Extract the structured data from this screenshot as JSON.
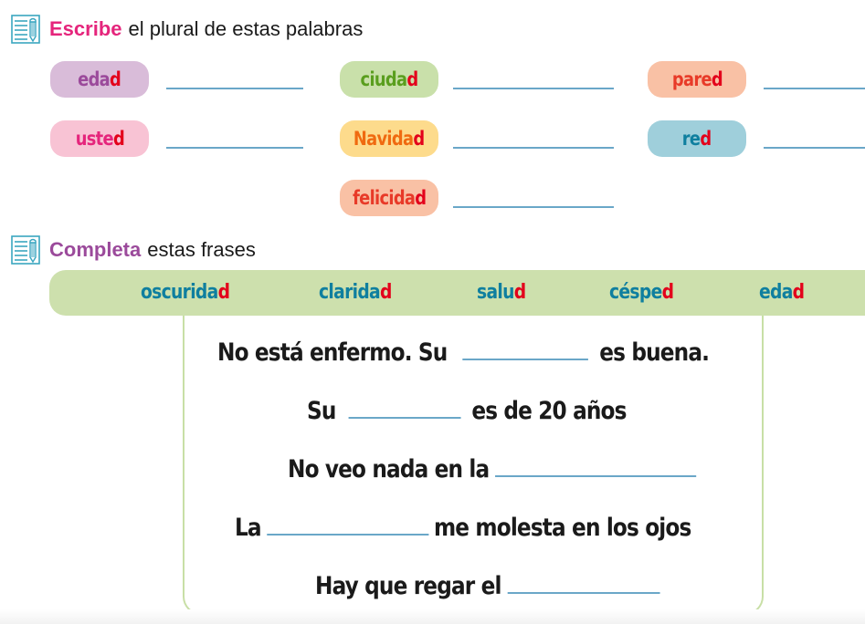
{
  "section1": {
    "icon": "notebook-pencil-icon",
    "keyword": "Escribe",
    "instruction": "el plural de estas palabras",
    "words": [
      {
        "stem": "eda",
        "ending": "d",
        "color": "#9b4a9b",
        "bg": "#d9bcd9"
      },
      {
        "stem": "ciuda",
        "ending": "d",
        "color": "#5a9e1e",
        "bg": "#c9e0aa"
      },
      {
        "stem": "pare",
        "ending": "d",
        "color": "#e83a28",
        "bg": "#f9c1a5"
      },
      {
        "stem": "uste",
        "ending": "d",
        "color": "#e5257c",
        "bg": "#f8c3d4"
      },
      {
        "stem": "Navida",
        "ending": "d",
        "color": "#f06a10",
        "bg": "#fddb8c"
      },
      {
        "stem": "re",
        "ending": "d",
        "color": "#0f7f9f",
        "bg": "#9fcfdb"
      },
      {
        "stem": "felicida",
        "ending": "d",
        "color": "#e83a28",
        "bg": "#f9c1a5"
      }
    ]
  },
  "section2": {
    "icon": "notebook-pencil-icon",
    "keyword": "Completa",
    "instruction": "estas frases",
    "word_bank": [
      {
        "stem": "oscurida",
        "ending": "d"
      },
      {
        "stem": "clarida",
        "ending": "d"
      },
      {
        "stem": "salu",
        "ending": "d"
      },
      {
        "stem": "céspe",
        "ending": "d"
      },
      {
        "stem": "eda",
        "ending": "d"
      }
    ],
    "sentences": [
      {
        "before": "No está enfermo. Su",
        "after": "es buena."
      },
      {
        "before": "Su",
        "after": "es de 20 años"
      },
      {
        "before": "No veo nada en la",
        "after": ""
      },
      {
        "before": "La",
        "after": "me molesta en los ojos"
      },
      {
        "before": "Hay que regar el",
        "after": ""
      }
    ]
  },
  "colors": {
    "ending_red": "#e3001b",
    "answer_line": "#6aa7c8",
    "word_bar": "#cde0ad",
    "word_bank_text": "#0f7f9f"
  }
}
